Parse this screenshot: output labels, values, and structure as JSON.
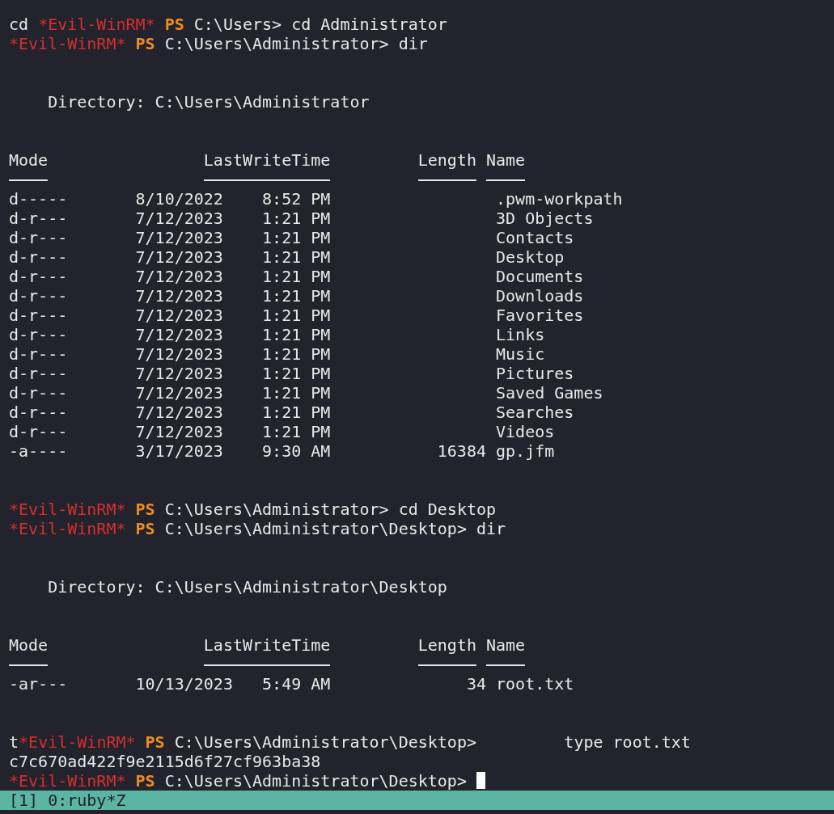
{
  "lines": [
    {
      "kind": "prompt",
      "prefix": "cd ",
      "marker": "*Evil-WinRM*",
      "shell": "PS",
      "path": "C:\\Users>",
      "command": "cd Administrator"
    },
    {
      "kind": "prompt",
      "marker": "*Evil-WinRM*",
      "shell": "PS",
      "path": "C:\\Users\\Administrator>",
      "command": "dir"
    },
    {
      "kind": "blank"
    },
    {
      "kind": "blank"
    },
    {
      "kind": "directory",
      "text": "Directory: C:\\Users\\Administrator"
    },
    {
      "kind": "blank"
    },
    {
      "kind": "blank"
    },
    {
      "kind": "table",
      "columns": [
        "Mode",
        "LastWriteTime",
        "Length",
        "Name"
      ],
      "rows": [
        {
          "mode": "d-----",
          "date": "8/10/2022",
          "time": "8:52 PM",
          "length": "",
          "name": ".pwm-workpath"
        },
        {
          "mode": "d-r---",
          "date": "7/12/2023",
          "time": "1:21 PM",
          "length": "",
          "name": "3D Objects"
        },
        {
          "mode": "d-r---",
          "date": "7/12/2023",
          "time": "1:21 PM",
          "length": "",
          "name": "Contacts"
        },
        {
          "mode": "d-r---",
          "date": "7/12/2023",
          "time": "1:21 PM",
          "length": "",
          "name": "Desktop"
        },
        {
          "mode": "d-r---",
          "date": "7/12/2023",
          "time": "1:21 PM",
          "length": "",
          "name": "Documents"
        },
        {
          "mode": "d-r---",
          "date": "7/12/2023",
          "time": "1:21 PM",
          "length": "",
          "name": "Downloads"
        },
        {
          "mode": "d-r---",
          "date": "7/12/2023",
          "time": "1:21 PM",
          "length": "",
          "name": "Favorites"
        },
        {
          "mode": "d-r---",
          "date": "7/12/2023",
          "time": "1:21 PM",
          "length": "",
          "name": "Links"
        },
        {
          "mode": "d-r---",
          "date": "7/12/2023",
          "time": "1:21 PM",
          "length": "",
          "name": "Music"
        },
        {
          "mode": "d-r---",
          "date": "7/12/2023",
          "time": "1:21 PM",
          "length": "",
          "name": "Pictures"
        },
        {
          "mode": "d-r---",
          "date": "7/12/2023",
          "time": "1:21 PM",
          "length": "",
          "name": "Saved Games"
        },
        {
          "mode": "d-r---",
          "date": "7/12/2023",
          "time": "1:21 PM",
          "length": "",
          "name": "Searches"
        },
        {
          "mode": "d-r---",
          "date": "7/12/2023",
          "time": "1:21 PM",
          "length": "",
          "name": "Videos"
        },
        {
          "mode": "-a----",
          "date": "3/17/2023",
          "time": "9:30 AM",
          "length": "16384",
          "name": "gp.jfm"
        }
      ]
    },
    {
      "kind": "blank"
    },
    {
      "kind": "blank"
    },
    {
      "kind": "prompt",
      "marker": "*Evil-WinRM*",
      "shell": "PS",
      "path": "C:\\Users\\Administrator>",
      "command": "cd Desktop"
    },
    {
      "kind": "prompt",
      "marker": "*Evil-WinRM*",
      "shell": "PS",
      "path": "C:\\Users\\Administrator\\Desktop>",
      "command": "dir"
    },
    {
      "kind": "blank"
    },
    {
      "kind": "blank"
    },
    {
      "kind": "directory",
      "text": "Directory: C:\\Users\\Administrator\\Desktop"
    },
    {
      "kind": "blank"
    },
    {
      "kind": "blank"
    },
    {
      "kind": "table",
      "columns": [
        "Mode",
        "LastWriteTime",
        "Length",
        "Name"
      ],
      "rows": [
        {
          "mode": "-ar---",
          "date": "10/13/2023",
          "time": "5:49 AM",
          "length": "34",
          "name": "root.txt"
        }
      ]
    },
    {
      "kind": "blank"
    },
    {
      "kind": "blank"
    },
    {
      "kind": "prompt",
      "prefix": "t",
      "marker": "*Evil-WinRM*",
      "shell": "PS",
      "path": "C:\\Users\\Administrator\\Desktop>",
      "command": "type root.txt",
      "gap": true
    },
    {
      "kind": "text",
      "text": "c7c670ad422f9e2115d6f27cf963ba38"
    },
    {
      "kind": "prompt",
      "marker": "*Evil-WinRM*",
      "shell": "PS",
      "path": "C:\\Users\\Administrator\\Desktop>",
      "cursor": true
    }
  ],
  "status_bar": {
    "text": "[1] 0:ruby*Z"
  }
}
